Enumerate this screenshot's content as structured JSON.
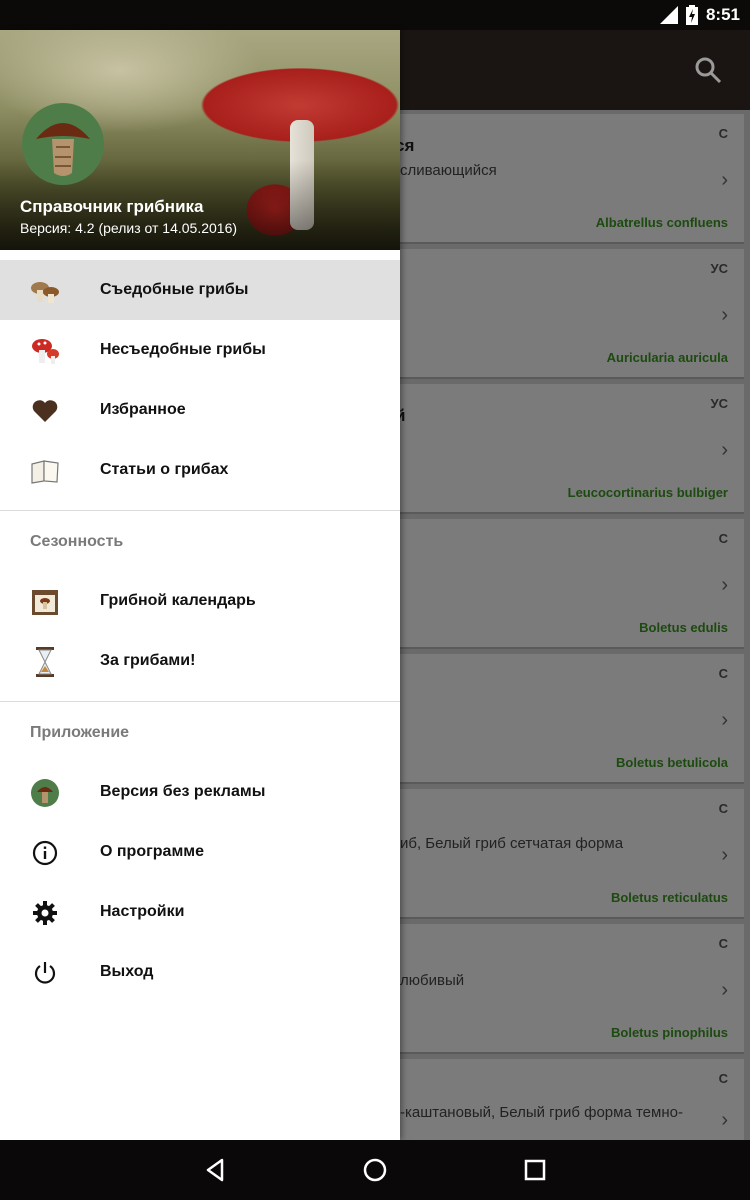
{
  "status_bar": {
    "time": "8:51",
    "signal_icon": "signal-icon",
    "battery_icon": "battery-charging-icon"
  },
  "toolbar": {
    "search_icon": "search-icon"
  },
  "list": [
    {
      "tag": "С",
      "title": "ся",
      "subtitle": "сливающийся",
      "latin": "Albatrellus confluens"
    },
    {
      "tag": "УС",
      "title": "",
      "subtitle": "",
      "latin": "Auricularia auricula"
    },
    {
      "tag": "УС",
      "title": "й",
      "subtitle": "",
      "latin": "Leucocortinarius bulbiger"
    },
    {
      "tag": "С",
      "title": "",
      "subtitle": "",
      "latin": "Boletus edulis"
    },
    {
      "tag": "С",
      "title": "",
      "subtitle": "",
      "latin": "Boletus betulicola"
    },
    {
      "tag": "С",
      "title": "",
      "subtitle": "иб, Белый гриб сетчатая форма",
      "latin": "Boletus reticulatus"
    },
    {
      "tag": "С",
      "title": "",
      "subtitle": "любивый",
      "latin": "Boletus pinophilus"
    },
    {
      "tag": "С",
      "title": "",
      "subtitle": "-каштановый, Белый гриб форма темно-",
      "latin": ""
    }
  ],
  "drawer": {
    "app_title": "Справочник грибника",
    "version": "Версия: 4.2 (релиз от 14.05.2016)",
    "main_items": [
      {
        "label": "Съедобные грибы",
        "icon": "edible-mushroom-icon"
      },
      {
        "label": "Несъедобные грибы",
        "icon": "inedible-mushroom-icon"
      },
      {
        "label": "Избранное",
        "icon": "heart-icon"
      },
      {
        "label": "Статьи о грибах",
        "icon": "book-icon"
      }
    ],
    "season_header": "Сезонность",
    "season_items": [
      {
        "label": "Грибной календарь",
        "icon": "calendar-icon"
      },
      {
        "label": "За грибами!",
        "icon": "hourglass-icon"
      }
    ],
    "app_header": "Приложение",
    "app_items": [
      {
        "label": "Версия без рекламы",
        "icon": "mushroom-avatar-icon"
      },
      {
        "label": "О программе",
        "icon": "info-icon"
      },
      {
        "label": "Настройки",
        "icon": "gear-icon"
      },
      {
        "label": "Выход",
        "icon": "power-icon"
      }
    ]
  },
  "nav_bar": {
    "back": "back-icon",
    "home": "home-icon",
    "recents": "recents-icon"
  },
  "colors": {
    "accent_green": "#1d4a10",
    "selected_bg": "#e0e0e0",
    "toolbar": "#1a1512"
  }
}
